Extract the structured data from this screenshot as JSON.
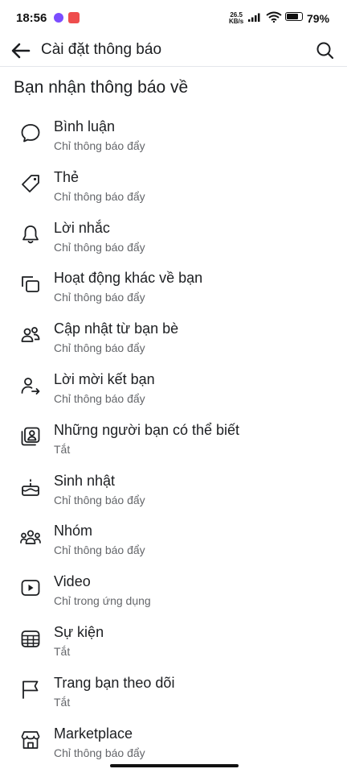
{
  "status_bar": {
    "time": "18:56",
    "net_speed_value": "26.5",
    "net_speed_unit": "KB/s",
    "battery_percent": "79%"
  },
  "header": {
    "title": "Cài đặt thông báo"
  },
  "section": {
    "title": "Bạn nhận thông báo về"
  },
  "items": [
    {
      "label": "Bình luận",
      "status": "Chỉ thông báo đẩy",
      "icon": "comment-icon"
    },
    {
      "label": "Thẻ",
      "status": "Chỉ thông báo đẩy",
      "icon": "tag-icon"
    },
    {
      "label": "Lời nhắc",
      "status": "Chỉ thông báo đẩy",
      "icon": "bell-icon"
    },
    {
      "label": "Hoạt động khác về bạn",
      "status": "Chỉ thông báo đẩy",
      "icon": "activity-icon"
    },
    {
      "label": "Cập nhật từ bạn bè",
      "status": "Chỉ thông báo đẩy",
      "icon": "friends-icon"
    },
    {
      "label": "Lời mời kết bạn",
      "status": "Chỉ thông báo đẩy",
      "icon": "friend-request-icon"
    },
    {
      "label": "Những người bạn có thể biết",
      "status": "Tắt",
      "icon": "people-you-may-know-icon"
    },
    {
      "label": "Sinh nhật",
      "status": "Chỉ thông báo đẩy",
      "icon": "birthday-cake-icon"
    },
    {
      "label": "Nhóm",
      "status": "Chỉ thông báo đẩy",
      "icon": "groups-icon"
    },
    {
      "label": "Video",
      "status": "Chỉ trong ứng dụng",
      "icon": "video-icon"
    },
    {
      "label": "Sự kiện",
      "status": "Tắt",
      "icon": "calendar-icon"
    },
    {
      "label": "Trang bạn theo dõi",
      "status": "Tắt",
      "icon": "flag-icon"
    },
    {
      "label": "Marketplace",
      "status": "Chỉ thông báo đẩy",
      "icon": "marketplace-shop-icon"
    }
  ]
}
